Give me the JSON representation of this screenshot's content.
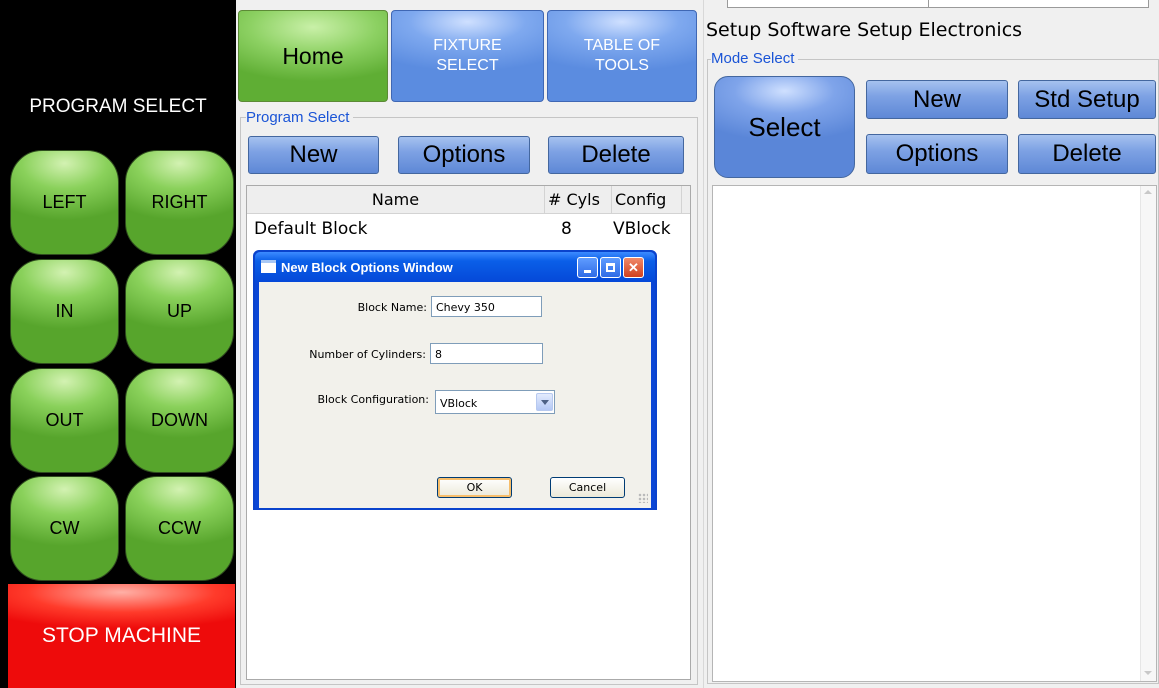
{
  "left_panel": {
    "title": "PROGRAM SELECT",
    "jog_buttons": [
      "LEFT",
      "RIGHT",
      "IN",
      "UP",
      "OUT",
      "DOWN",
      "CW",
      "CCW"
    ],
    "stop_label": "STOP MACHINE"
  },
  "tabs": {
    "home": "Home",
    "fixture_line1": "FIXTURE",
    "fixture_line2": "SELECT",
    "tools_line1": "TABLE OF",
    "tools_line2": "TOOLS"
  },
  "program_select": {
    "group_title": "Program Select",
    "buttons": {
      "new": "New",
      "options": "Options",
      "delete": "Delete"
    },
    "columns": [
      "Name",
      "# Cyls",
      "Config"
    ],
    "rows": [
      {
        "name": "Default Block",
        "cyls": "8",
        "config": "VBlock"
      }
    ]
  },
  "setup_menu": {
    "software": "Setup Software",
    "electronics": "Setup Electronics"
  },
  "mode_select": {
    "group_title": "Mode Select",
    "buttons": {
      "select": "Select",
      "new": "New",
      "std_setup": "Std Setup",
      "options": "Options",
      "delete": "Delete"
    }
  },
  "dialog": {
    "title": "New Block Options Window",
    "block_name_label": "Block Name:",
    "block_name_value": "Chevy 350",
    "cylinders_label": "Number of Cylinders:",
    "cylinders_value": "8",
    "config_label": "Block Configuration:",
    "config_value": "VBlock",
    "ok": "OK",
    "cancel": "Cancel"
  },
  "colors": {
    "jog_green": "#7cc94b",
    "stop_red": "#ff1a10",
    "button_blue": "#6f96e0",
    "group_title_blue": "#1a54d6",
    "dialog_title_blue": "#0a5fe8"
  }
}
